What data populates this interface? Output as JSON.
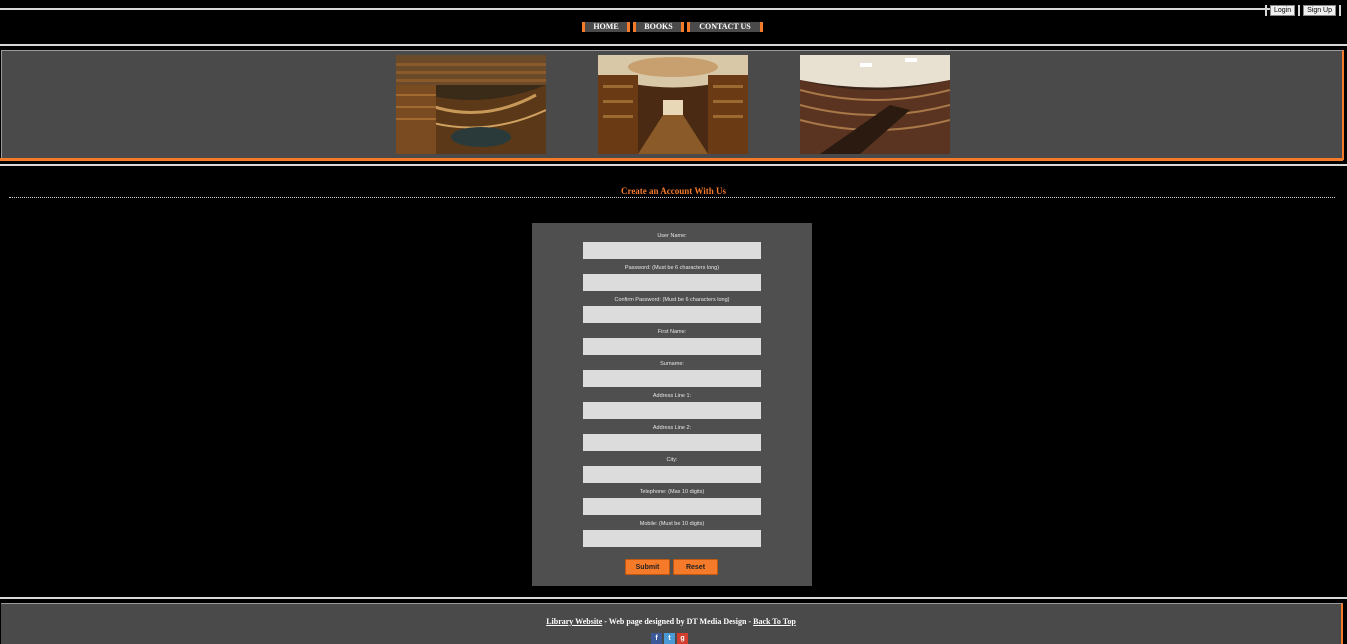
{
  "auth": {
    "login": "Login",
    "signup": "Sign Up"
  },
  "nav": {
    "home": "HOME",
    "books": "BOOKS",
    "contact": "CONTACT US"
  },
  "heading": "Create an Account With Us",
  "form": {
    "fields": [
      {
        "label": "User Name:"
      },
      {
        "label": "Password: (Must be 6 characters long)"
      },
      {
        "label": "Confirm Password: (Must be 6 characters long)"
      },
      {
        "label": "First Name:"
      },
      {
        "label": "Surname:"
      },
      {
        "label": "Address Line 1:"
      },
      {
        "label": "Address Line 2:"
      },
      {
        "label": "City:"
      },
      {
        "label": "Telephone: (Max 10 digits)"
      },
      {
        "label": "Mobile: (Must be 10 digits)"
      }
    ],
    "submit": "Submit",
    "reset": "Reset"
  },
  "footer": {
    "site_link": "Library Website",
    "middle": " - Web page designed by DT Media Design - ",
    "top_link": "Back To Top"
  },
  "social": [
    "facebook-icon",
    "twitter-icon",
    "google-plus-icon"
  ],
  "colors": {
    "accent": "#f57a2a",
    "panel": "#4a4a4a",
    "background": "#000000"
  }
}
